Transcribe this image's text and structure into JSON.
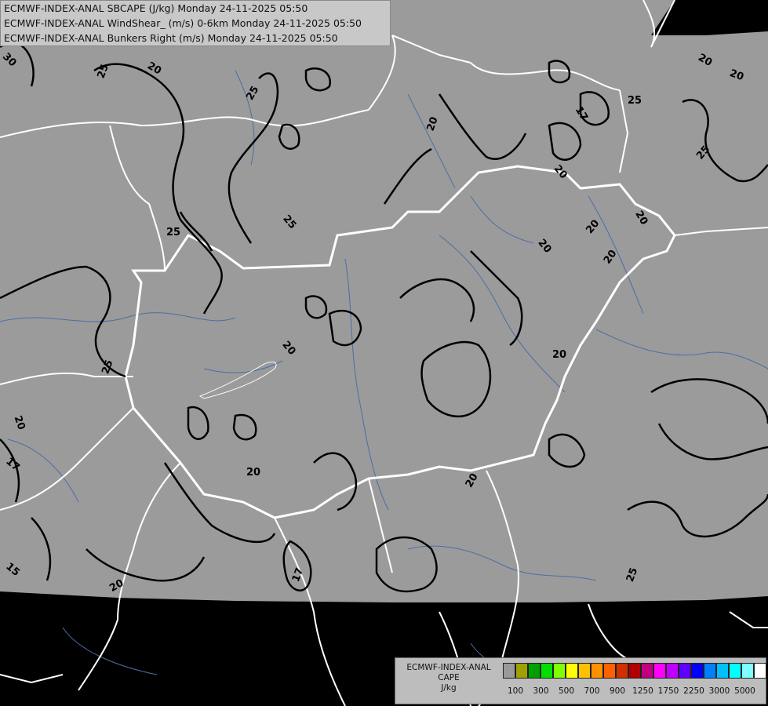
{
  "header": {
    "line1": "ECMWF-INDEX-ANAL SBCAPE (J/kg) Monday 24-11-2025 05:50",
    "line2": "ECMWF-INDEX-ANAL WindShear_ (m/s) 0-6km Monday 24-11-2025 05:50",
    "line3": "ECMWF-INDEX-ANAL Bunkers Right (m/s) Monday 24-11-2025 05:50"
  },
  "legend": {
    "title1": "ECMWF-INDEX-ANAL",
    "title2": "CAPE",
    "title3": "J/kg",
    "swatches": [
      "#9a9a9a",
      "#a0a000",
      "#00a000",
      "#00e000",
      "#80ff00",
      "#ffff00",
      "#ffc000",
      "#ff9000",
      "#ff6000",
      "#d03000",
      "#b00000",
      "#c00080",
      "#ff00ff",
      "#c000ff",
      "#6000ff",
      "#0000ff",
      "#0080ff",
      "#00c0ff",
      "#00ffff",
      "#80ffff",
      "#ffffff"
    ],
    "ticks": [
      "100",
      "300",
      "500",
      "700",
      "900",
      "1250",
      "1750",
      "2250",
      "3000",
      "5000"
    ]
  },
  "colors": {
    "data_area": "#9b9b9b",
    "no_data": "#000000",
    "borders": "#ffffff",
    "rivers": "#4a6fa5",
    "contours": "#000000"
  },
  "contour_labels": [
    "30",
    "25",
    "20",
    "25",
    "20",
    "17",
    "20",
    "25",
    "20",
    "25",
    "20",
    "20",
    "20",
    "25",
    "25",
    "20",
    "20",
    "25",
    "20",
    "20",
    "20",
    "20",
    "17",
    "20",
    "15",
    "17",
    "20",
    "25"
  ]
}
